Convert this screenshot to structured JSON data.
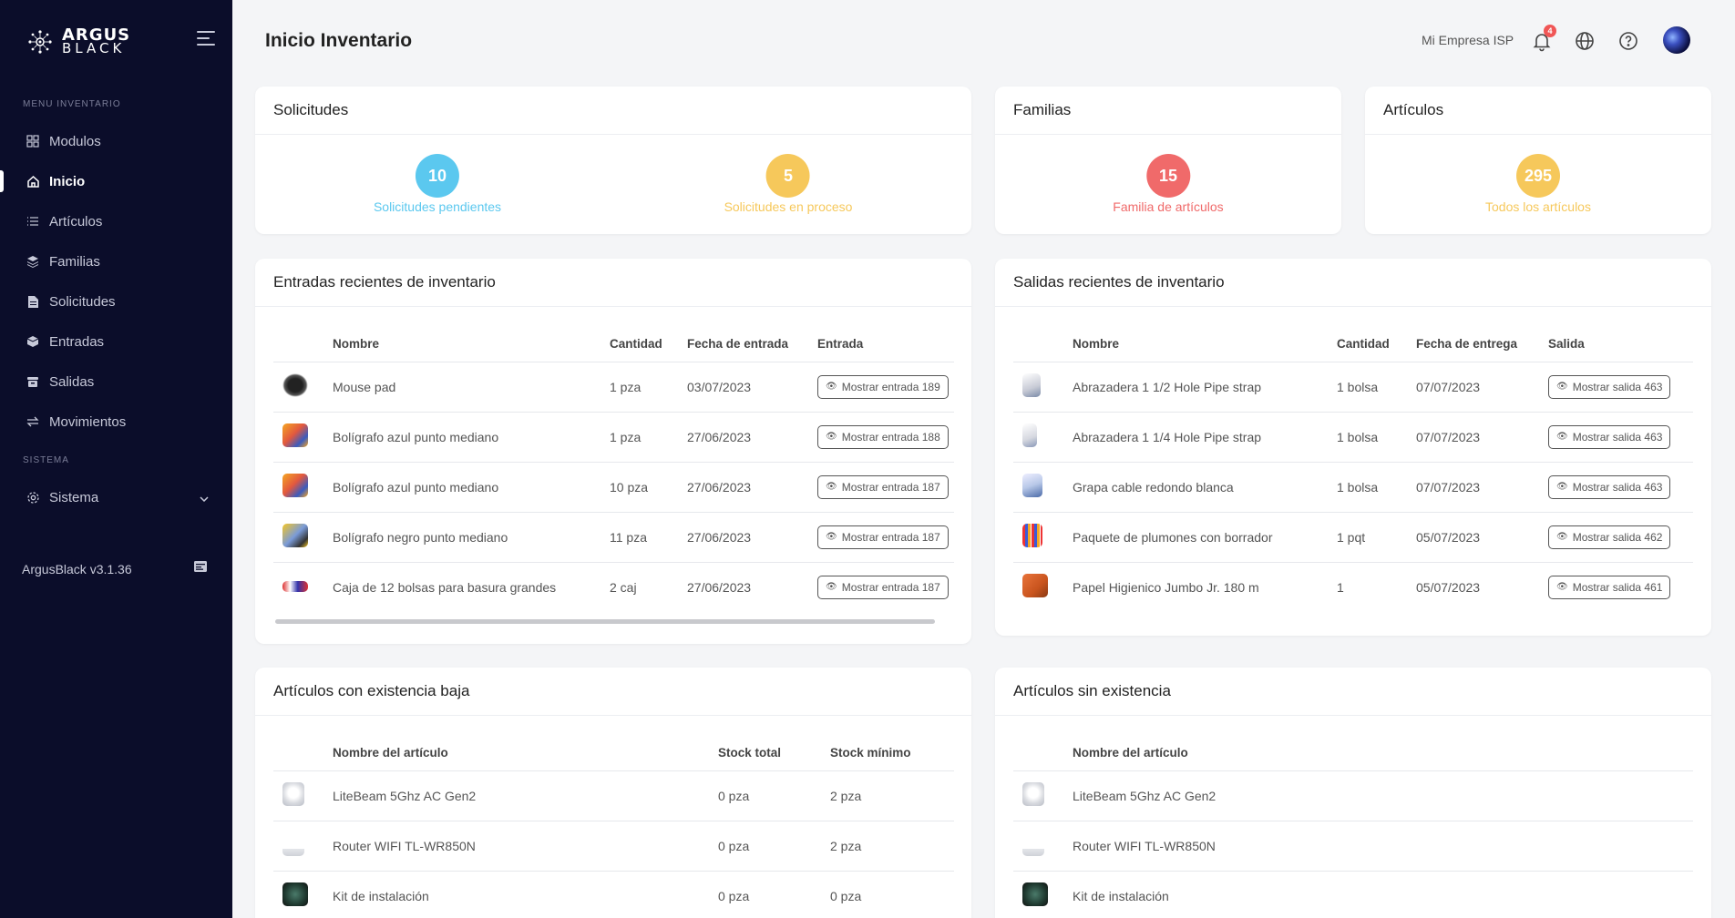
{
  "sidebar": {
    "logo_line1": "ARGUS",
    "logo_line2": "BLACK",
    "section_inventory": "MENU INVENTARIO",
    "section_system": "SISTEMA",
    "items": [
      {
        "label": "Modulos",
        "icon": "grid-icon"
      },
      {
        "label": "Inicio",
        "icon": "home-icon",
        "active": true
      },
      {
        "label": "Artículos",
        "icon": "list-icon"
      },
      {
        "label": "Familias",
        "icon": "layers-icon"
      },
      {
        "label": "Solicitudes",
        "icon": "document-icon"
      },
      {
        "label": "Entradas",
        "icon": "box-icon"
      },
      {
        "label": "Salidas",
        "icon": "archive-icon"
      },
      {
        "label": "Movimientos",
        "icon": "swap-icon"
      },
      {
        "label": "Sistema",
        "icon": "gear-icon"
      }
    ],
    "version": "ArgusBlack v3.1.36"
  },
  "header": {
    "title": "Inicio Inventario",
    "company": "Mi Empresa ISP",
    "notification_count": "4"
  },
  "colors": {
    "sidebar_bg": "#0b0d2a",
    "blue": "#5bc8ef",
    "yellow": "#f6c85b",
    "red": "#f06a6a"
  },
  "solicitudes": {
    "title": "Solicitudes",
    "pending_count": "10",
    "pending_label": "Solicitudes pendientes",
    "process_count": "5",
    "process_label": "Solicitudes en proceso"
  },
  "familias": {
    "title": "Familias",
    "count": "15",
    "label": "Familia de artículos"
  },
  "articulos": {
    "title": "Artículos",
    "count": "295",
    "label": "Todos los artículos"
  },
  "entradas": {
    "title": "Entradas recientes de inventario",
    "headers": [
      "Nombre",
      "Cantidad",
      "Fecha de entrada",
      "Entrada"
    ],
    "rows": [
      {
        "name": "Mouse pad",
        "qty": "1 pza",
        "date": "03/07/2023",
        "action": "Mostrar entrada 189"
      },
      {
        "name": "Bolígrafo azul punto mediano",
        "qty": "1 pza",
        "date": "27/06/2023",
        "action": "Mostrar entrada 188"
      },
      {
        "name": "Bolígrafo azul punto mediano",
        "qty": "10 pza",
        "date": "27/06/2023",
        "action": "Mostrar entrada 187"
      },
      {
        "name": "Bolígrafo negro punto mediano",
        "qty": "11 pza",
        "date": "27/06/2023",
        "action": "Mostrar entrada 187"
      },
      {
        "name": "Caja de 12 bolsas para basura grandes",
        "qty": "2 caj",
        "date": "27/06/2023",
        "action": "Mostrar entrada 187"
      }
    ]
  },
  "salidas": {
    "title": "Salidas recientes de inventario",
    "headers": [
      "Nombre",
      "Cantidad",
      "Fecha de entrega",
      "Salida"
    ],
    "rows": [
      {
        "name": "Abrazadera 1 1/2 Hole Pipe strap",
        "qty": "1 bolsa",
        "date": "07/07/2023",
        "action": "Mostrar salida 463"
      },
      {
        "name": "Abrazadera 1 1/4 Hole Pipe strap",
        "qty": "1 bolsa",
        "date": "07/07/2023",
        "action": "Mostrar salida 463"
      },
      {
        "name": "Grapa cable redondo blanca",
        "qty": "1 bolsa",
        "date": "07/07/2023",
        "action": "Mostrar salida 463"
      },
      {
        "name": "Paquete de plumones con borrador",
        "qty": "1 pqt",
        "date": "05/07/2023",
        "action": "Mostrar salida 462"
      },
      {
        "name": "Papel Higienico Jumbo Jr. 180 m",
        "qty": "1",
        "date": "05/07/2023",
        "action": "Mostrar salida 461"
      }
    ]
  },
  "baja": {
    "title": "Artículos con existencia baja",
    "headers": [
      "Nombre del artículo",
      "Stock total",
      "Stock mínimo"
    ],
    "rows": [
      {
        "name": "LiteBeam 5Ghz AC Gen2",
        "total": "0 pza",
        "min": "2 pza"
      },
      {
        "name": "Router WIFI TL-WR850N",
        "total": "0 pza",
        "min": "2 pza"
      },
      {
        "name": "Kit de instalación",
        "total": "0 pza",
        "min": "0 pza"
      }
    ]
  },
  "sin": {
    "title": "Artículos sin existencia",
    "headers": [
      "Nombre del artículo"
    ],
    "rows": [
      {
        "name": "LiteBeam 5Ghz AC Gen2"
      },
      {
        "name": "Router WIFI TL-WR850N"
      },
      {
        "name": "Kit de instalación"
      }
    ]
  }
}
